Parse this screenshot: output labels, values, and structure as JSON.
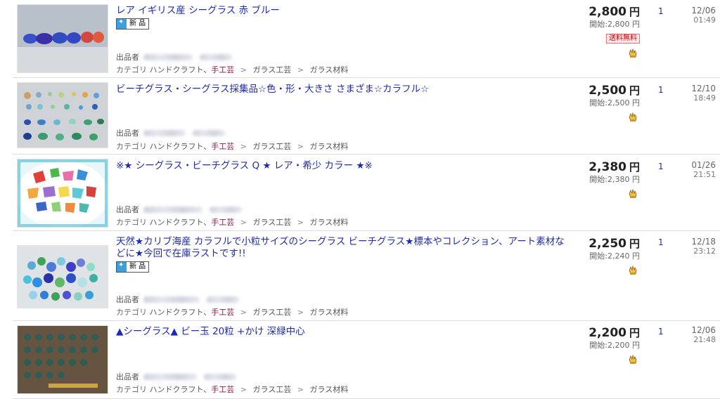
{
  "items": [
    {
      "title": "レア イギリス産 シーグラス 赤 ブルー",
      "new": true,
      "new_label": "新 品",
      "seller_label": "出品者",
      "category_root": "カテゴリ",
      "category_1": "ハンドクラフト、",
      "category_2": "手工芸",
      "sep": ">",
      "category_3": "ガラス工芸",
      "category_4": "ガラス材料",
      "price": "2,800",
      "yen": "円",
      "start": "開始:2,800 円",
      "free_shipping": "送料無料",
      "bids": "1",
      "date": "12/06",
      "time": "01:49"
    },
    {
      "title": "ビーチグラス・シーグラス採集品☆色・形・大きさ さまざま☆カラフル☆",
      "new": false,
      "seller_label": "出品者",
      "category_root": "カテゴリ",
      "category_1": "ハンドクラフト、",
      "category_2": "手工芸",
      "sep": ">",
      "category_3": "ガラス工芸",
      "category_4": "ガラス材料",
      "price": "2,500",
      "yen": "円",
      "start": "開始:2,500 円",
      "bids": "1",
      "date": "12/10",
      "time": "18:49"
    },
    {
      "title": "※★ シーグラス・ビーチグラス Q ★ レア・希少 カラー ★※",
      "new": false,
      "seller_label": "出品者",
      "category_root": "カテゴリ",
      "category_1": "ハンドクラフト、",
      "category_2": "手工芸",
      "sep": ">",
      "category_3": "ガラス工芸",
      "category_4": "ガラス材料",
      "price": "2,380",
      "yen": "円",
      "start": "開始:2,380 円",
      "bids": "1",
      "date": "01/26",
      "time": "21:51"
    },
    {
      "title_line1": "天然★カリブ海産 カラフルで小粒サイズのシーグラス ビーチグラス★標本やコレクション、アート素材な",
      "title_line2": "どに★今回で在庫ラストです!!",
      "new": true,
      "new_label": "新 品",
      "seller_label": "出品者",
      "category_root": "カテゴリ",
      "category_1": "ハンドクラフト、",
      "category_2": "手工芸",
      "sep": ">",
      "category_3": "ガラス工芸",
      "category_4": "ガラス材料",
      "price": "2,250",
      "yen": "円",
      "start": "開始:2,240 円",
      "bids": "1",
      "date": "12/18",
      "time": "23:12"
    },
    {
      "title": "▲シーグラス▲ ビー玉 20粒 +かけ 深緑中心",
      "new": false,
      "seller_label": "出品者",
      "category_root": "カテゴリ",
      "category_1": "ハンドクラフト、",
      "category_2": "手工芸",
      "sep": ">",
      "category_3": "ガラス工芸",
      "category_4": "ガラス材料",
      "price": "2,200",
      "yen": "円",
      "start": "開始:2,200 円",
      "bids": "1",
      "date": "12/06",
      "time": "21:48"
    }
  ],
  "icons": {
    "new": "new-item-icon",
    "watch": "hand-watch-icon"
  },
  "colors": {
    "title_link": "#1e2bb0",
    "category_highlight": "#8a1a44",
    "shipping_free": "#c00000"
  }
}
